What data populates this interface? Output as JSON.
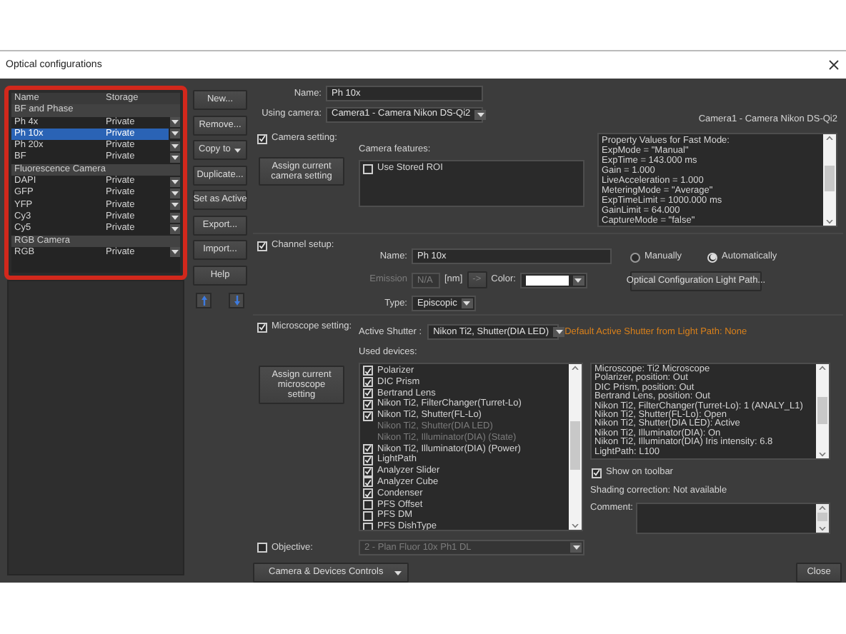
{
  "window": {
    "title": "Optical configurations"
  },
  "config_list": {
    "columns": [
      "Name",
      "Storage"
    ],
    "groups": [
      {
        "name": "BF and Phase",
        "items": [
          {
            "name": "Ph 4x",
            "storage": "Private",
            "selected": false
          },
          {
            "name": "Ph 10x",
            "storage": "Private",
            "selected": true
          },
          {
            "name": "Ph 20x",
            "storage": "Private",
            "selected": false
          },
          {
            "name": "BF",
            "storage": "Private",
            "selected": false
          }
        ]
      },
      {
        "name": "Fluorescence Camera",
        "items": [
          {
            "name": "DAPI",
            "storage": "Private",
            "selected": false
          },
          {
            "name": "GFP",
            "storage": "Private",
            "selected": false
          },
          {
            "name": "YFP",
            "storage": "Private",
            "selected": false
          },
          {
            "name": "Cy3",
            "storage": "Private",
            "selected": false
          },
          {
            "name": "Cy5",
            "storage": "Private",
            "selected": false
          }
        ]
      },
      {
        "name": "RGB Camera",
        "items": [
          {
            "name": "RGB",
            "storage": "Private",
            "selected": false
          }
        ]
      }
    ]
  },
  "side_buttons": [
    {
      "label": "New...",
      "kind": "plain"
    },
    {
      "label": "Remove...",
      "kind": "plain"
    },
    {
      "label": "Copy to",
      "kind": "dropdown"
    },
    {
      "label": "Duplicate...",
      "kind": "plain"
    },
    {
      "label": "Set as Active",
      "kind": "plain"
    },
    {
      "label": "Export...",
      "kind": "plain"
    },
    {
      "label": "Import...",
      "kind": "plain"
    },
    {
      "label": "Help",
      "kind": "plain"
    }
  ],
  "name_field": {
    "label": "Name:",
    "value": "Ph 10x"
  },
  "camera": {
    "label": "Using camera:",
    "value": "Camera1 - Camera Nikon DS-Qi2",
    "caption": "Camera1 - Camera Nikon DS-Qi2"
  },
  "camera_setting": {
    "label": "Camera setting:",
    "checked": true,
    "assign_button": "Assign current camera setting",
    "features_label": "Camera features:",
    "features": [
      {
        "label": "Use Stored ROI",
        "checked": false
      }
    ],
    "property_lines": [
      "Property Values for Fast Mode:",
      "ExpMode = \"Manual\"",
      "ExpTime = 143.000 ms",
      "Gain = 1.000",
      "LiveAcceleration = 1.000",
      "MeteringMode = \"Average\"",
      "ExpTimeLimit = 1000.000 ms",
      "GainLimit = 64.000",
      "CaptureMode = \"false\""
    ]
  },
  "channel_setup": {
    "label": "Channel setup:",
    "checked": true,
    "name_label": "Name:",
    "name_value": "Ph 10x",
    "emission_label": "Emission",
    "emission_value": "N/A",
    "unit": "[nm]",
    "arrow": "->",
    "color_label": "Color:",
    "color": "#ffffff",
    "type_label": "Type:",
    "type_value": "Episcopic",
    "modes": [
      {
        "label": "Manually",
        "selected": false
      },
      {
        "label": "Automatically",
        "selected": true
      }
    ],
    "light_path_button": "Optical Configuration Light Path..."
  },
  "microscope_setting": {
    "label": "Microscope setting:",
    "checked": true,
    "assign_button": "Assign current microscope setting",
    "shutter_label": "Active Shutter :",
    "shutter_value": "Nikon Ti2, Shutter(DIA LED)",
    "shutter_note": "Default Active Shutter from Light Path: None",
    "devices_label": "Used devices:",
    "devices": [
      {
        "label": "Polarizer",
        "kind": "checkbox",
        "checked": true
      },
      {
        "label": "DIC Prism",
        "kind": "checkbox",
        "checked": true
      },
      {
        "label": "Bertrand Lens",
        "kind": "checkbox",
        "checked": true
      },
      {
        "label": "Nikon Ti2, FilterChanger(Turret-Lo)",
        "kind": "checkbox",
        "checked": true
      },
      {
        "label": "Nikon Ti2, Shutter(FL-Lo)",
        "kind": "checkbox",
        "checked": true
      },
      {
        "label": "Nikon Ti2, Shutter(DIA LED)",
        "kind": "fixed"
      },
      {
        "label": "Nikon Ti2, Illuminator(DIA) (State)",
        "kind": "fixed"
      },
      {
        "label": "Nikon Ti2, Illuminator(DIA) (Power)",
        "kind": "checkbox",
        "checked": true
      },
      {
        "label": "LightPath",
        "kind": "checkbox",
        "checked": true
      },
      {
        "label": "Analyzer Slider",
        "kind": "checkbox",
        "checked": true
      },
      {
        "label": "Analyzer Cube",
        "kind": "checkbox",
        "checked": true
      },
      {
        "label": "Condenser",
        "kind": "checkbox",
        "checked": true
      },
      {
        "label": "PFS Offset",
        "kind": "checkbox",
        "checked": false
      },
      {
        "label": "PFS DM",
        "kind": "checkbox",
        "checked": false
      },
      {
        "label": "PFS DishType",
        "kind": "checkbox",
        "checked": false
      }
    ],
    "status_lines": [
      "Microscope: Ti2 Microscope",
      "Polarizer, position: Out",
      "DIC Prism, position: Out",
      "Bertrand Lens, position: Out",
      "Nikon Ti2, FilterChanger(Turret-Lo): 1 (ANALY_L1)",
      "Nikon Ti2, Shutter(FL-Lo): Open",
      "Nikon Ti2, Shutter(DIA LED): Active",
      "Nikon Ti2, Illuminator(DIA): On",
      "Nikon Ti2, Illuminator(DIA) Iris intensity: 6.8",
      "LightPath: L100"
    ],
    "show_on_toolbar": {
      "label": "Show on toolbar",
      "checked": true
    },
    "shading_label": "Shading correction:",
    "shading_value": "Not available",
    "comment_label": "Comment:"
  },
  "objective": {
    "label": "Objective:",
    "checked": false,
    "value": "2 - Plan Fluor 10x Ph1 DL"
  },
  "footer": {
    "controls_button": "Camera & Devices Controls",
    "close_button": "Close"
  }
}
